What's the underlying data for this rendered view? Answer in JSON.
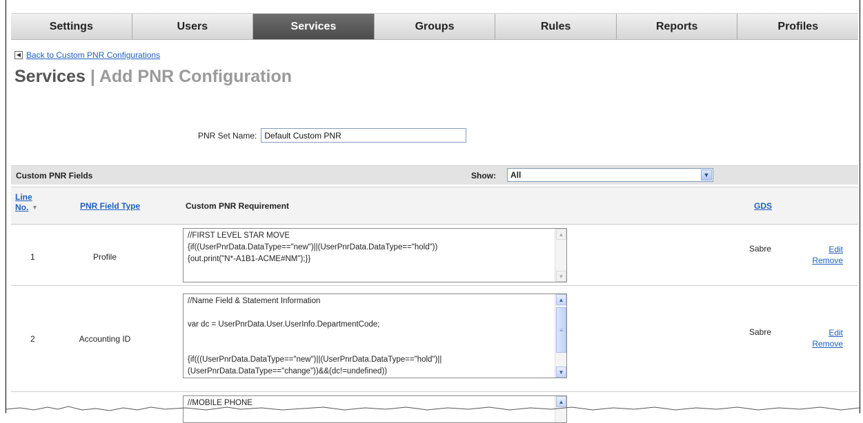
{
  "nav": {
    "tabs": [
      {
        "label": "Settings"
      },
      {
        "label": "Users"
      },
      {
        "label": "Services",
        "active": true
      },
      {
        "label": "Groups"
      },
      {
        "label": "Rules"
      },
      {
        "label": "Reports"
      },
      {
        "label": "Profiles"
      }
    ]
  },
  "back_link": {
    "label": "Back to Custom PNR Configurations"
  },
  "page": {
    "title": "Services",
    "separator": "|",
    "subtitle": "Add PNR Configuration"
  },
  "pnr_set": {
    "label": "PNR Set Name:",
    "value": "Default Custom PNR"
  },
  "section": {
    "title": "Custom PNR Fields",
    "show_label": "Show:",
    "show_value": "All"
  },
  "columns": {
    "line_no_1": "Line",
    "line_no_2": "No.",
    "field_type": "PNR Field Type",
    "requirement": "Custom PNR Requirement",
    "gds": "GDS"
  },
  "rows": [
    {
      "line": "1",
      "type": "Profile",
      "requirement": "//FIRST LEVEL STAR MOVE\n{if((UserPnrData.DataType==\"new\")||(UserPnrData.DataType==\"hold\"))\n{out.print(\"N*-A1B1-ACME#NM\");}}",
      "gds": "Sabre",
      "edit": "Edit",
      "remove": "Remove"
    },
    {
      "line": "2",
      "type": "Accounting ID",
      "requirement": "//Name Field & Statement Information\n\nvar dc = UserPnrData.User.UserInfo.DepartmentCode;\n\n\n{if(((UserPnrData.DataType==\"new\")||(UserPnrData.DataType==\"hold\")||\n(UserPnrData.DataType==\"change\"))&&(dc!=undefined))",
      "gds": "Sabre",
      "edit": "Edit",
      "remove": "Remove"
    },
    {
      "requirement": "//MOBILE PHONE"
    }
  ],
  "colors": {
    "link": "#1f5fbf",
    "active_tab": "#555555",
    "title_main": "#555555",
    "title_sub": "#9a9a9a"
  }
}
